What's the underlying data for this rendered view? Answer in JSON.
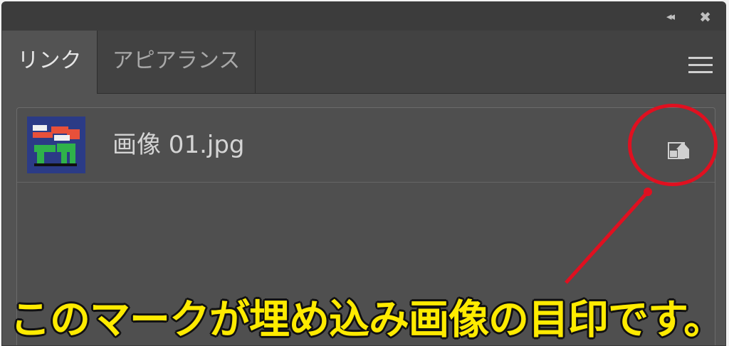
{
  "panel": {
    "title_controls": {
      "collapse_glyph": "◂◂",
      "close_glyph": "✖"
    },
    "tabs": [
      {
        "label": "リンク",
        "active": true
      },
      {
        "label": "アピアランス",
        "active": false
      }
    ]
  },
  "links": [
    {
      "filename": "画像 01.jpg",
      "status_icon": "embedded-image-icon",
      "thumbnail": "logo-thumbnail"
    }
  ],
  "annotation": {
    "caption": "このマークが埋め込み画像の目印です。",
    "color": "#e01020",
    "caption_color": "#ffeb00"
  },
  "colors": {
    "panel_bg": "#535353",
    "tabbar_bg": "#424242",
    "titlebar_bg": "#3c3c3c"
  }
}
